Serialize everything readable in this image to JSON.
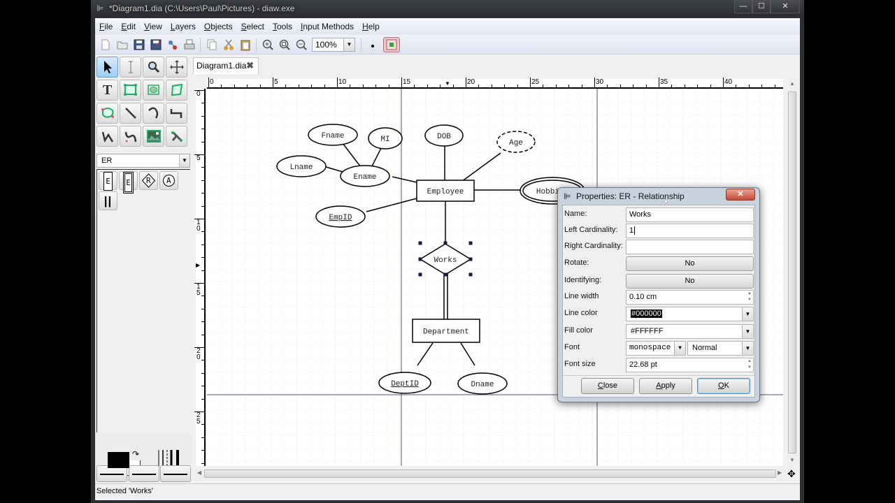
{
  "window": {
    "title": "*Diagram1.dia (C:\\Users\\Paul\\Pictures) - diaw.exe",
    "controls": {
      "minimize": "—",
      "maximize": "☐",
      "close": "✕"
    }
  },
  "menubar": {
    "items": [
      {
        "label": "File",
        "mnemonic": "F"
      },
      {
        "label": "Edit",
        "mnemonic": "E"
      },
      {
        "label": "View",
        "mnemonic": "V"
      },
      {
        "label": "Layers",
        "mnemonic": "L"
      },
      {
        "label": "Objects",
        "mnemonic": "O"
      },
      {
        "label": "Select",
        "mnemonic": "S"
      },
      {
        "label": "Tools",
        "mnemonic": "T"
      },
      {
        "label": "Input Methods",
        "mnemonic": "I"
      },
      {
        "label": "Help",
        "mnemonic": "H"
      }
    ]
  },
  "toolbar": {
    "buttons": [
      "new-icon",
      "open-icon",
      "save-icon",
      "save-as-icon",
      "export-icon",
      "print-icon",
      "copy-icon",
      "cut-icon",
      "paste-icon",
      "zoom-in-icon",
      "zoom-fit-icon",
      "zoom-out-icon"
    ],
    "zoom_value": "100%"
  },
  "toolbox": {
    "tools": [
      "pointer",
      "text-edit",
      "magnify",
      "scroll",
      "text",
      "box",
      "ellipse",
      "polygon",
      "beziergon",
      "line",
      "arc",
      "zigzag-line",
      "polyline",
      "bezier-line",
      "image",
      "outline"
    ]
  },
  "sheet": {
    "selected": "ER",
    "shapes": [
      {
        "name": "entity",
        "glyph": "E"
      },
      {
        "name": "weak-entity",
        "glyph": "E"
      },
      {
        "name": "relationship",
        "glyph": "R"
      },
      {
        "name": "attribute",
        "glyph": "A"
      },
      {
        "name": "participation",
        "glyph": "||"
      }
    ]
  },
  "colors": {
    "foreground": "#000000",
    "background": "#FFFFFF"
  },
  "tab": {
    "label": "Diagram1.dia",
    "close": "✖"
  },
  "ruler": {
    "top_labels": [
      "0",
      "5",
      "10",
      "15",
      "20",
      "25",
      "30",
      "35",
      "40"
    ],
    "left_labels": [
      "0",
      "5",
      "10",
      "15",
      "20",
      "25"
    ]
  },
  "diagram": {
    "entities": [
      {
        "label": "Employee"
      },
      {
        "label": "Department"
      }
    ],
    "relationship": {
      "label": "Works"
    },
    "attributes": [
      {
        "label": "Fname"
      },
      {
        "label": "MI"
      },
      {
        "label": "Lname"
      },
      {
        "label": "Ename"
      },
      {
        "label": "EmpID",
        "key": true
      },
      {
        "label": "DOB"
      },
      {
        "label": "Age",
        "derived": true
      },
      {
        "label": "Hobbies",
        "multivalued": true
      },
      {
        "label": "DeptID",
        "key": true
      },
      {
        "label": "Dname"
      }
    ]
  },
  "dialog": {
    "title": "Properties: ER - Relationship",
    "close_glyph": "✕",
    "fields": {
      "name": {
        "label": "Name:",
        "value": "Works"
      },
      "left_cardinality": {
        "label": "Left Cardinality:",
        "value": "1"
      },
      "right_cardinality": {
        "label": "Right Cardinality:",
        "value": ""
      },
      "rotate": {
        "label": "Rotate:",
        "value": "No"
      },
      "identifying": {
        "label": "Identifying:",
        "value": "No"
      },
      "line_width": {
        "label": "Line width",
        "value": "0.10 cm"
      },
      "line_color": {
        "label": "Line color",
        "value": "#000000"
      },
      "fill_color": {
        "label": "Fill color",
        "value": "#FFFFFF"
      },
      "font": {
        "label": "Font",
        "family": "monospace",
        "style": "Normal"
      },
      "font_size": {
        "label": "Font size",
        "value": "22.68 pt"
      }
    },
    "buttons": {
      "close": {
        "label": "Close",
        "mnemonic": "C"
      },
      "apply": {
        "label": "Apply",
        "mnemonic": "A"
      },
      "ok": {
        "label": "OK",
        "mnemonic": "O"
      }
    }
  },
  "status": {
    "text": "Selected 'Works'"
  }
}
